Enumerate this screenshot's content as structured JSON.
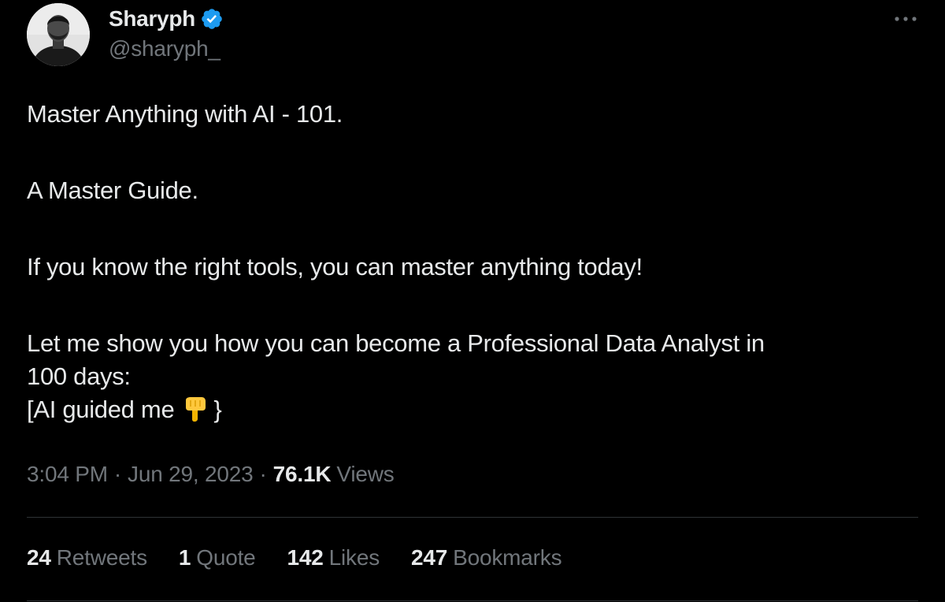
{
  "author": {
    "display_name": "Sharyph",
    "handle": "@sharyph_",
    "verified": true,
    "avatar_icon": "profile-photo"
  },
  "more_icon": "more-horizontal-icon",
  "tweet": {
    "line1": "Master Anything with AI - 101.",
    "line2": "A Master Guide.",
    "line3": "If you know the right tools, you can master anything today!",
    "line4a": "Let me show you how you can become a Professional Data Analyst in",
    "line4b": "100 days:",
    "line5_prefix": "[AI guided me",
    "line5_emoji": "backhand-index-pointing-down",
    "line5_suffix": "}"
  },
  "meta": {
    "time": "3:04 PM",
    "separator": "·",
    "date": "Jun 29, 2023",
    "views_count": "76.1K",
    "views_label": "Views"
  },
  "stats": {
    "retweets_count": "24",
    "retweets_label": "Retweets",
    "quotes_count": "1",
    "quotes_label": "Quote",
    "likes_count": "142",
    "likes_label": "Likes",
    "bookmarks_count": "247",
    "bookmarks_label": "Bookmarks"
  },
  "colors": {
    "background": "#000000",
    "primary_text": "#e7e9ea",
    "secondary_text": "#71767b",
    "verified_blue": "#1d9bf0",
    "divider": "#2f3336"
  }
}
